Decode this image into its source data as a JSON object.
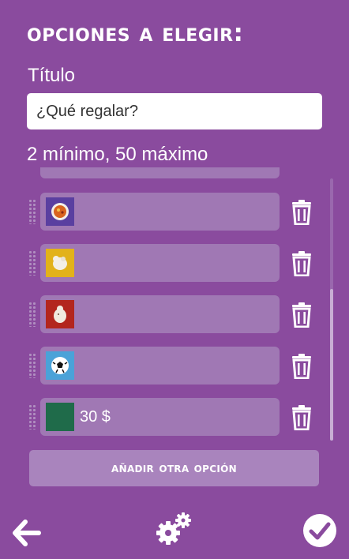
{
  "header": {
    "title": "opciones a elegir:"
  },
  "form": {
    "title_label": "Título",
    "title_value": "¿Qué regalar?",
    "count_hint": "2 mínimo, 50 máximo"
  },
  "options": [
    {
      "image": "food-bowl-thumbnail",
      "text": ""
    },
    {
      "image": "white-figure-yellow-thumbnail",
      "text": ""
    },
    {
      "image": "white-figure-red-thumbnail",
      "text": ""
    },
    {
      "image": "soccer-ball-thumbnail",
      "text": ""
    },
    {
      "image": "green-swatch-thumbnail",
      "text": "30 $"
    }
  ],
  "actions": {
    "add_option_label": "añadir otra opción"
  },
  "icons": {
    "delete": "trash-icon",
    "drag": "drag-handle-icon",
    "back": "arrow-left-icon",
    "settings": "gears-icon",
    "confirm": "check-circle-icon"
  },
  "colors": {
    "background": "#8a4b9e",
    "card": "#a078b4",
    "button": "#a984bd"
  }
}
